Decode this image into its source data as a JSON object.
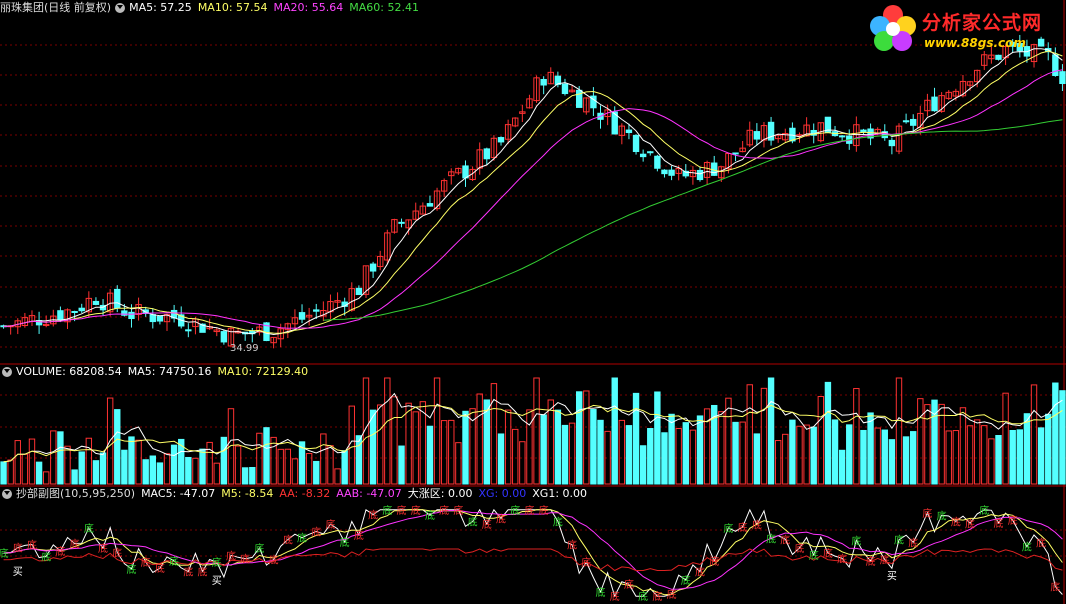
{
  "main": {
    "stock_title": "丽珠集团(日线 前复权)",
    "ma5": "MA5: 57.25",
    "ma10": "MA10: 57.54",
    "ma20": "MA20: 55.64",
    "ma60": "MA60: 52.41",
    "low_label": "34.99"
  },
  "volume": {
    "label": "VOLUME: 68208.54",
    "ma5": "MA5: 74750.16",
    "ma10": "MA10: 72129.40"
  },
  "sub": {
    "label": "抄部副图(10,5,95,250)",
    "mac5": "MAC5: -47.07",
    "m5": "M5: -8.54",
    "aa": "AA: -8.32",
    "aab": "AAB: -47.07",
    "dzq": "大涨区: 0.00",
    "xg": "XG: 0.00",
    "xg1": "XG1: 0.00",
    "signal_bottom": "底",
    "signal_buy": "买"
  },
  "logo": {
    "name": "分析家公式网",
    "url": "www.88gs.com"
  },
  "colors": {
    "up": "#ff3232",
    "down": "#54ffff",
    "ma5": "#ffffff",
    "ma10": "#ffff66",
    "ma20": "#ff33ff",
    "ma60": "#33cc33",
    "grid": "#7a0000"
  }
}
